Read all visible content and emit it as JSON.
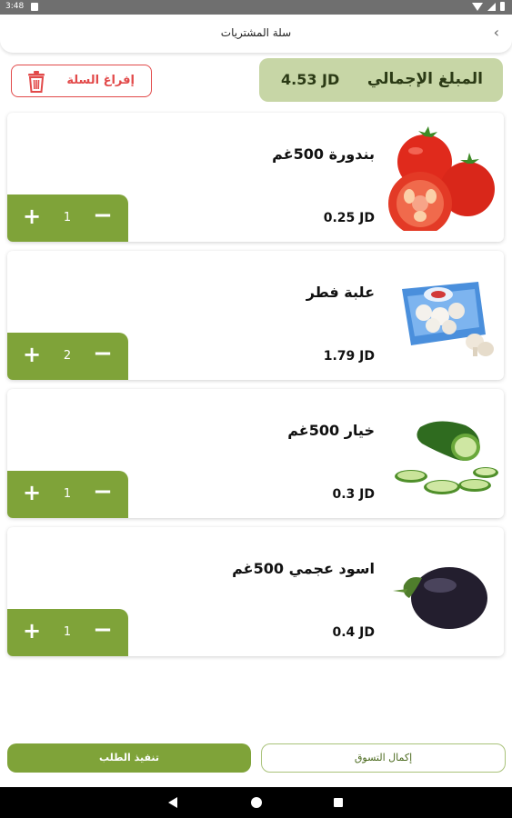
{
  "status_bar": {
    "time": "3:48"
  },
  "header": {
    "title": "سلة المشتريات",
    "back_icon": "‹"
  },
  "empty_cart": {
    "label": "إفراغ السلة"
  },
  "total": {
    "label": "المبلغ الإجمالي",
    "value": "4.53 JD"
  },
  "items": [
    {
      "name": "بندورة 500غم",
      "price": "0.25 JD",
      "qty": "1",
      "image": "tomato-image"
    },
    {
      "name": "علبة فطر",
      "price": "1.79 JD",
      "qty": "2",
      "image": "mushroom-box-image"
    },
    {
      "name": "خيار 500غم",
      "price": "0.3 JD",
      "qty": "1",
      "image": "cucumber-image"
    },
    {
      "name": "اسود عجمي 500غم",
      "price": "0.4 JD",
      "qty": "1",
      "image": "eggplant-image"
    }
  ],
  "qty_controls": {
    "plus": "+",
    "minus": "−"
  },
  "footer": {
    "checkout_label": "تنفيذ الطلب",
    "continue_label": "إكمال التسوق"
  },
  "colors": {
    "primary_green": "#7fa339",
    "total_bg": "#c7d6a6",
    "danger_red": "#e24a4a"
  }
}
